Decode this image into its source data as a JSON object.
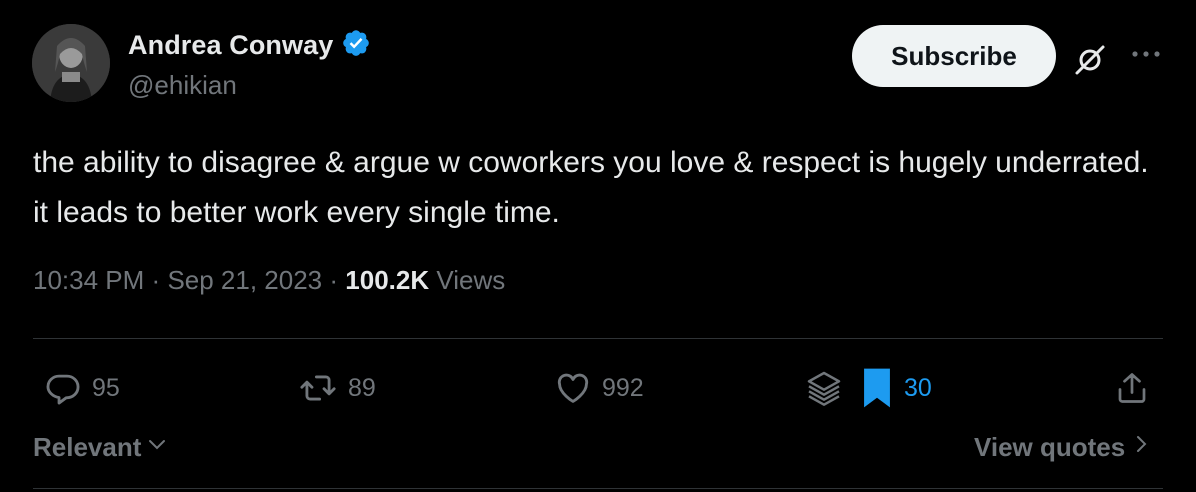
{
  "author": {
    "name": "Andrea Conway",
    "handle": "@ehikian",
    "verified_color": "#1d9bf0"
  },
  "header": {
    "subscribe_label": "Subscribe",
    "grok_icon": "grok-icon",
    "more_icon": "more-icon"
  },
  "tweet": {
    "text": "the ability to disagree & argue w coworkers you love & respect is hugely underrated. it leads to better work every single time.",
    "time": "10:34 PM",
    "separator": "·",
    "date": "Sep 21, 2023",
    "views_count": "100.2K",
    "views_label": "Views"
  },
  "actions": {
    "replies": "95",
    "reposts": "89",
    "likes": "992",
    "bookmarks": "30",
    "bookmark_color": "#1d9bf0"
  },
  "footer": {
    "sort_label": "Relevant",
    "view_quotes_label": "View quotes"
  }
}
